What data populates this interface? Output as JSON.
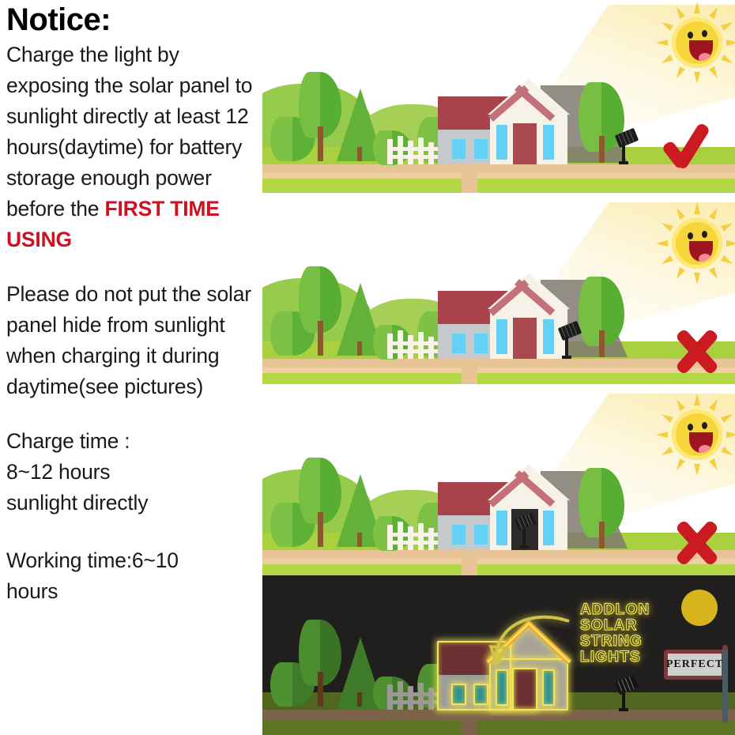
{
  "notice": {
    "title": "Notice:",
    "para1_a": "Charge the light by exposing the solar panel to sunlight directly at least 12 hours(daytime) for battery storage enough power before the ",
    "para1_highlight": "FIRST TIME USING",
    "para2": "Please do not put the solar panel hide from sunlight when charging it during daytime(see pictures)",
    "para3_line1": "Charge time :",
    "para3_line2": "8~12 hours",
    "para3_line3": "sunlight directly",
    "para4_line1": "Working time:6~10",
    "para4_line2": "hours"
  },
  "colors": {
    "highlight_red": "#cc1122",
    "mark_red": "#cc1a22",
    "sun_yellow": "#f7d63c",
    "grass_far": "#a9d13f",
    "grass_near": "#b2d845",
    "path": "#e8c396",
    "roof_red": "#a8424b",
    "wall_gray": "#c6c9cb",
    "window_blue": "#63d0f5",
    "night_bg": "#211f1e",
    "glow_yellow": "#f2e552",
    "moon_gold": "#d8b41c"
  },
  "scenes": [
    {
      "id": "scene-1",
      "name": "daytime-panel-in-sunlight",
      "status_icon": "check-icon",
      "status_label": "correct",
      "lamp_position": "outdoors-in-sunlight",
      "sun": "smiling-sun-icon",
      "time_of_day": "day"
    },
    {
      "id": "scene-2",
      "name": "daytime-panel-in-shadow",
      "status_icon": "cross-icon",
      "status_label": "incorrect",
      "lamp_position": "outdoors-in-tree-shadow",
      "sun": "smiling-sun-icon",
      "time_of_day": "day"
    },
    {
      "id": "scene-3",
      "name": "daytime-panel-indoors",
      "status_icon": "cross-icon",
      "status_label": "incorrect",
      "lamp_position": "indoors-behind-door",
      "sun": "smiling-sun-icon",
      "time_of_day": "day"
    },
    {
      "id": "scene-4",
      "name": "nighttime-lights-on",
      "status_icon": "perfect-sign",
      "status_label": "perfect",
      "lamp_position": "outdoors",
      "sun": "crescent-moon-icon",
      "time_of_day": "night"
    }
  ],
  "night": {
    "brand_lines": [
      "ADDLON",
      "SOLAR",
      "STRING",
      "LIGHTS"
    ],
    "sign_label": "PERFECT",
    "arrow": "curved-arrow-icon",
    "moon": "crescent-moon-icon"
  }
}
